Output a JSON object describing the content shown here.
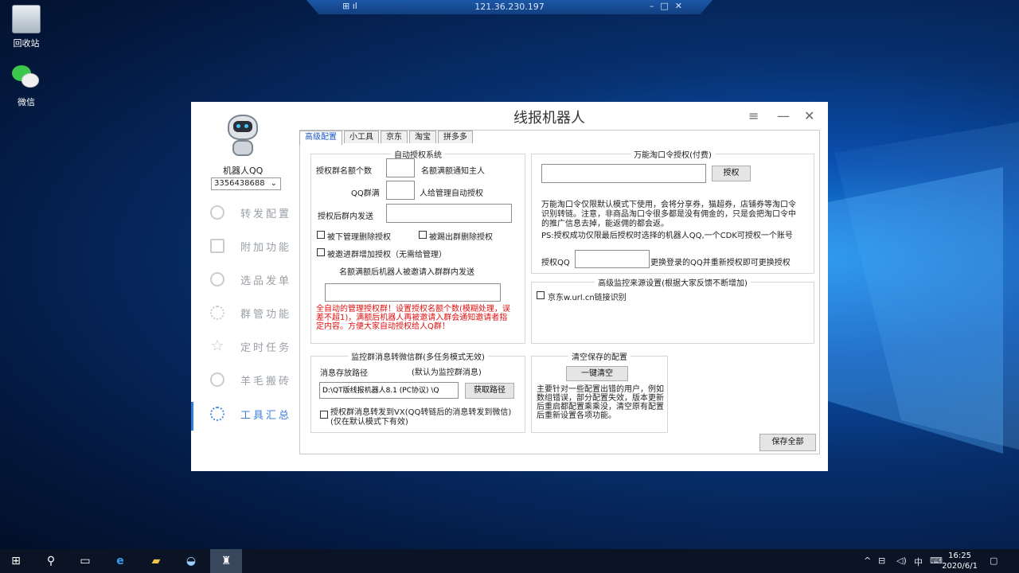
{
  "remote": {
    "ip": "121.36.230.197",
    "controls": "–□✕"
  },
  "desktop": [
    {
      "label": "回收站"
    },
    {
      "label": "微信"
    }
  ],
  "app": {
    "title": "线报机器人",
    "robot_name": "机器人QQ",
    "qq_number": "3356438688",
    "nav": [
      {
        "label": "转发配置",
        "icon": "chat-icon"
      },
      {
        "label": "附加功能",
        "icon": "document-icon"
      },
      {
        "label": "选品发单",
        "icon": "chat-icon"
      },
      {
        "label": "群管功能",
        "icon": "gear-icon"
      },
      {
        "label": "定时任务",
        "icon": "star-icon"
      },
      {
        "label": "羊毛搬砖",
        "icon": "chat-icon"
      },
      {
        "label": "工具汇总",
        "icon": "gear-icon",
        "active": true
      }
    ],
    "tabs": [
      "高级配置",
      "小工具",
      "京东",
      "淘宝",
      "拼多多"
    ],
    "auth_system": {
      "legend": "自动授权系统",
      "group_count_label": "授权群名额个数",
      "notify_owner_label": "名额满额通知主人",
      "qq_group_full_label": "QQ群满",
      "admin_auto_label": "人给管理自动授权",
      "send_after_label": "授权后群内发送",
      "cb_kick_admin": "被下管理删除授权",
      "cb_kicked_group": "被踢出群删除授权",
      "cb_invited": "被邀进群增加授权（无需给管理）",
      "full_invite_label": "名额满额后机器人被邀请入群群内发送",
      "red_note": "全自动的管理授权群！设置授权名额个数(模糊处理，误差不超1)，满额后机器人再被邀请入群会通知邀请者指定内容。方便大家自动授权给人Q群！"
    },
    "forward": {
      "legend": "监控群消息转微信群(多任务模式无效)",
      "path_label": "消息存放路径",
      "default_label": "(默认为监控群消息)",
      "path_value": "D:\\QT版线报机器人8.1 (PC协议) \\Q",
      "get_path_button": "获取路径",
      "cb_forward": "授权群消息转发到VX(QQ转链后的消息转发到微信)(仅在默认模式下有效)"
    },
    "token": {
      "legend": "万能淘口令授权(付费)",
      "authorize_button": "授权",
      "desc": "万能淘口令仅限默认模式下使用，会将分享券，猫超券，店铺券等淘口令识别转链。注意，非商品淘口令很多都是没有佣金的，只是会把淘口令中的推广信息去掉，能返佣的都会返。",
      "ps": "PS:授权成功仅限最后授权时选择的机器人QQ,一个CDK可授权一个账号",
      "qq_label": "授权QQ",
      "change_hint": "更换登录的QQ并重新授权即可更换授权"
    },
    "monitor": {
      "legend": "高级监控来源设置(根据大家反馈不断增加)",
      "cb_jd": "京东w.url.cn链接识别"
    },
    "clear": {
      "legend": "清空保存的配置",
      "button": "一键清空",
      "desc": "主要针对一些配置出错的用户，例如数组错误，部分配置失效，版本更新后重启都配置乘乘没，清空原有配置后重新设置各项功能。"
    },
    "save_all": "保存全部"
  },
  "taskbar": {
    "time": "16:25",
    "date": "2020/6/1",
    "ime": "中"
  }
}
